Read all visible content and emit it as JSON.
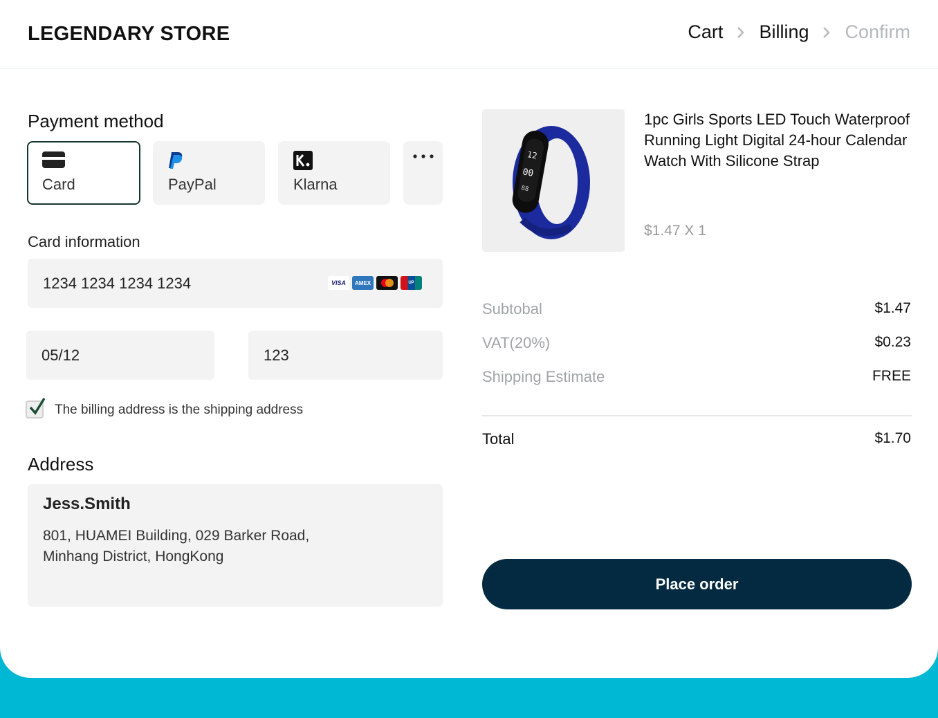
{
  "header": {
    "logo": "LEGENDARY STORE",
    "breadcrumbs": [
      "Cart",
      "Billing",
      "Confirm"
    ]
  },
  "payment": {
    "title": "Payment method",
    "methods": [
      {
        "label": "Card",
        "icon": "credit-card-icon",
        "selected": true
      },
      {
        "label": "PayPal",
        "icon": "paypal-icon",
        "selected": false
      },
      {
        "label": "Klarna",
        "icon": "klarna-icon",
        "selected": false
      }
    ],
    "more_icon": "more-dots-icon"
  },
  "card": {
    "title": "Card information",
    "number": "1234 1234 1234 1234",
    "expiry": "05/12",
    "cvc": "123",
    "brands": [
      "visa-icon",
      "amex-icon",
      "mastercard-icon",
      "unionpay-icon"
    ]
  },
  "billing_checkbox": {
    "label": "The billing address is the shipping address",
    "checked": true
  },
  "address": {
    "title": "Address",
    "name": "Jess.Smith",
    "line1": "801, HUAMEI Building, 029 Barker Road,",
    "line2": "Minhang District, HongKong"
  },
  "product": {
    "title": "1pc Girls Sports LED Touch Waterproof Running Light Digital 24-hour Calendar Watch With Silicone Strap",
    "price_qty": "$1.47 X 1",
    "image_icon": "watch-product-image"
  },
  "summary": {
    "subtotal_label": "Subtobal",
    "subtotal_value": "$1.47",
    "vat_label": "VAT(20%)",
    "vat_value": "$0.23",
    "shipping_label": "Shipping Estimate",
    "shipping_value": "FREE",
    "total_label": "Total",
    "total_value": "$1.70"
  },
  "place_order_label": "Place order",
  "colors": {
    "accent": "#00b8d4",
    "button": "#032a40",
    "selected_border": "#16352c"
  }
}
